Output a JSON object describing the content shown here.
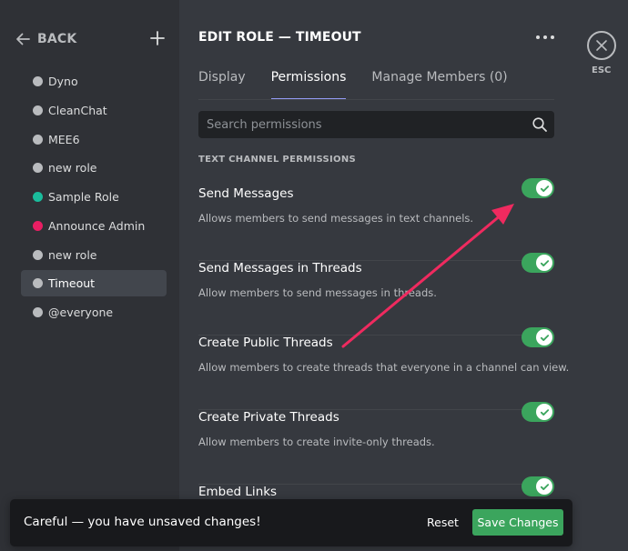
{
  "sidebar": {
    "back_label": "BACK",
    "roles": [
      {
        "name": "Dyno",
        "color": "#b9bbbe"
      },
      {
        "name": "CleanChat",
        "color": "#b9bbbe"
      },
      {
        "name": "MEE6",
        "color": "#b9bbbe"
      },
      {
        "name": "new role",
        "color": "#b9bbbe"
      },
      {
        "name": "Sample Role",
        "color": "#1abc9c"
      },
      {
        "name": "Announce Admin",
        "color": "#e91e63"
      },
      {
        "name": "new role",
        "color": "#b9bbbe"
      },
      {
        "name": "Timeout",
        "color": "#b9bbbe",
        "selected": true
      },
      {
        "name": "@everyone",
        "color": "#b9bbbe"
      }
    ]
  },
  "header": {
    "title": "EDIT ROLE — TIMEOUT",
    "tabs": [
      {
        "label": "Display",
        "active": false
      },
      {
        "label": "Permissions",
        "active": true
      },
      {
        "label": "Manage Members (0)",
        "active": false
      }
    ]
  },
  "search": {
    "placeholder": "Search permissions",
    "value": ""
  },
  "section_header": "TEXT CHANNEL PERMISSIONS",
  "permissions": [
    {
      "title": "Send Messages",
      "description": "Allows members to send messages in text channels.",
      "enabled": true
    },
    {
      "title": "Send Messages in Threads",
      "description": "Allow members to send messages in threads.",
      "enabled": true
    },
    {
      "title": "Create Public Threads",
      "description": "Allow members to create threads that everyone in a channel can view.",
      "enabled": true
    },
    {
      "title": "Create Private Threads",
      "description": "Allow members to create invite-only threads.",
      "enabled": true
    },
    {
      "title": "Embed Links",
      "description": "",
      "enabled": true
    }
  ],
  "esc": {
    "label": "ESC"
  },
  "notice": {
    "text": "Careful — you have unsaved changes!",
    "reset_label": "Reset",
    "save_label": "Save Changes"
  },
  "colors": {
    "accent_green": "#3ba55d",
    "tab_underline": "#949cf7",
    "annotation_arrow": "#ef2a5f"
  },
  "icons": {
    "back": "arrow-left-icon",
    "add": "plus-icon",
    "more": "ellipsis-icon",
    "search": "magnifier-icon",
    "toggle": "check-icon",
    "close": "close-icon"
  }
}
